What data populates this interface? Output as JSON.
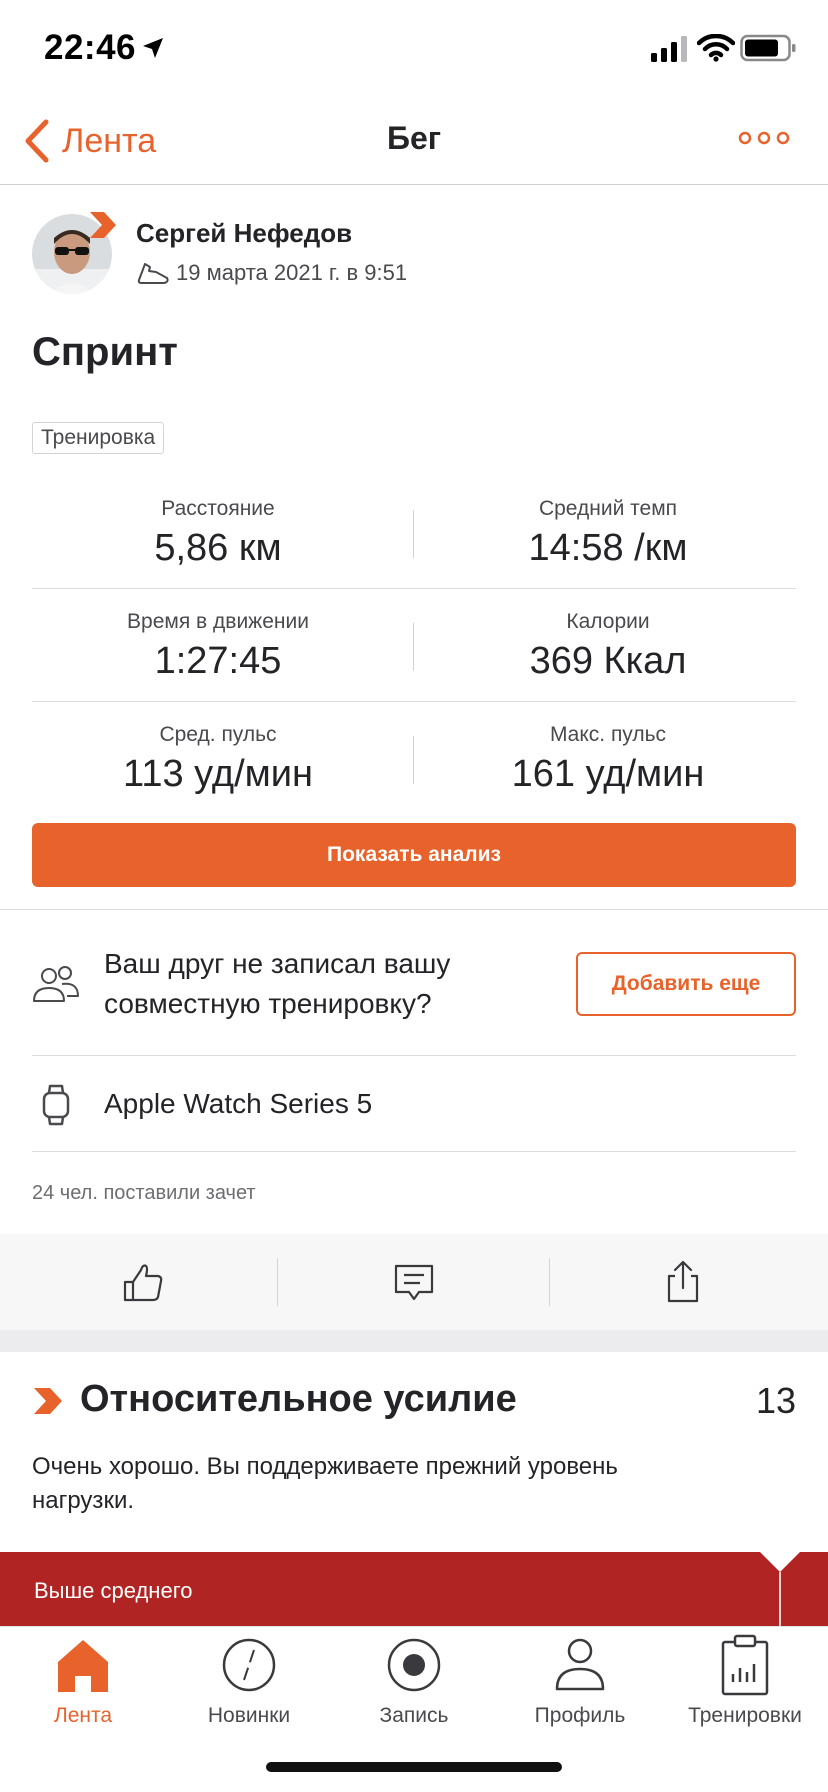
{
  "status_bar": {
    "time": "22:46"
  },
  "nav": {
    "back_label": "Лента",
    "title": "Бег"
  },
  "athlete": {
    "name": "Сергей Нефедов",
    "date": "19 марта 2021 г. в 9:51"
  },
  "activity": {
    "title": "Sprint",
    "title_display": "Спринт",
    "tag": "Тренировка",
    "stats": [
      {
        "label": "Расстояние",
        "value": "5,86 км"
      },
      {
        "label": "Средний темп",
        "value": "14:58 /км"
      },
      {
        "label": "Время в движении",
        "value": "1:27:45"
      },
      {
        "label": "Калории",
        "value": "369 Ккал"
      },
      {
        "label": "Сред. пульс",
        "value": "113 уд/мин"
      },
      {
        "label": "Макс. пульс",
        "value": "161 уд/мин"
      }
    ],
    "analysis_button": "Показать анализ"
  },
  "friends": {
    "prompt": "Ваш друг не записал вашу совместную тренировку?",
    "add_button": "Добавить еще"
  },
  "device": {
    "name": "Apple Watch Series 5"
  },
  "kudos": {
    "text": "24 чел. поставили зачет"
  },
  "relative_effort": {
    "title": "Относительное усилие",
    "score": "13",
    "description": "Очень хорошо. Вы поддерживаете прежний уровень нагрузки.",
    "band_label": "Выше среднего"
  },
  "tabs": [
    {
      "label": "Лента",
      "icon": "home-icon"
    },
    {
      "label": "Новинки",
      "icon": "compass-icon"
    },
    {
      "label": "Запись",
      "icon": "record-icon"
    },
    {
      "label": "Профиль",
      "icon": "profile-icon"
    },
    {
      "label": "Тренировки",
      "icon": "clipboard-chart-icon"
    }
  ],
  "colors": {
    "accent": "#E8632C",
    "effort_band": "#B02524",
    "text": "#242428"
  }
}
